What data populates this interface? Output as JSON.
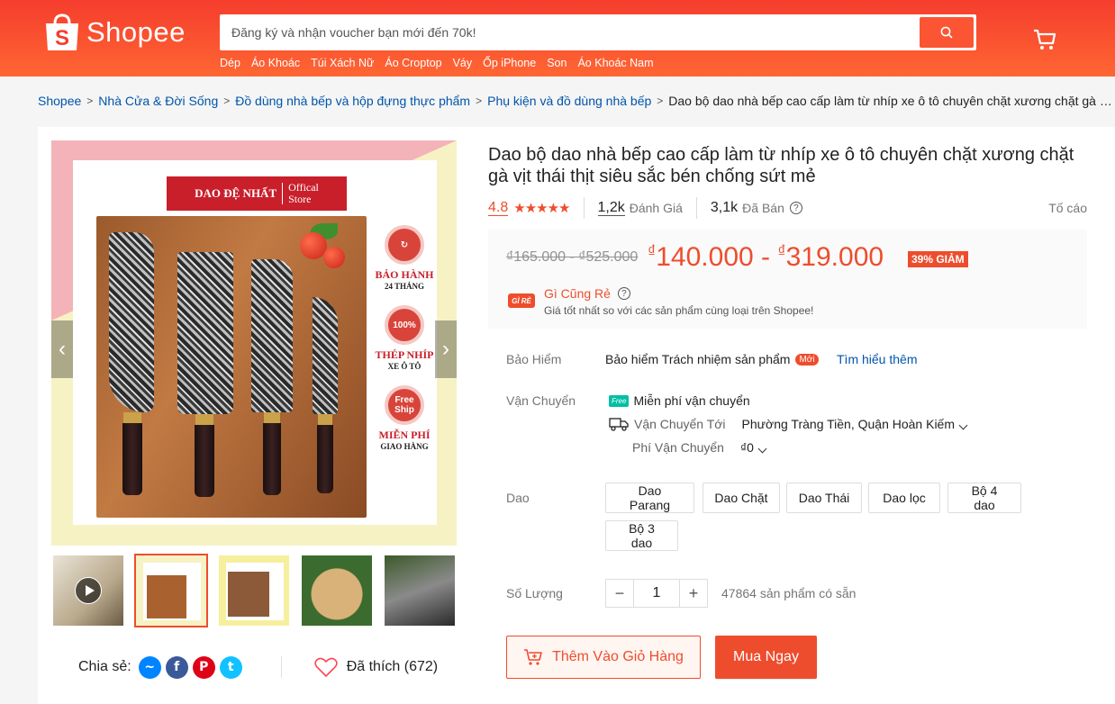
{
  "brand": {
    "name": "Shopee",
    "color": "#ee4d2d"
  },
  "search": {
    "placeholder": "Đăng ký và nhận voucher bạn mới đến 70k!",
    "suggestions": [
      "Dép",
      "Áo Khoác",
      "Túi Xách Nữ",
      "Áo Croptop",
      "Váy",
      "Ốp iPhone",
      "Son",
      "Áo Khoác Nam"
    ]
  },
  "breadcrumb": {
    "items": [
      "Shopee",
      "Nhà Cửa & Đời Sống",
      "Đồ dùng nhà bếp và hộp đựng thực phẩm",
      "Phụ kiện và đồ dùng nhà bếp"
    ],
    "current": "Dao bộ dao nhà bếp cao cấp làm từ nhíp xe ô tô chuyên chặt xương chặt gà vịt thái thịt siêu sắc bén chống sứt mẻ"
  },
  "product": {
    "title": "Dao bộ dao nhà bếp cao cấp làm từ nhíp xe ô tô chuyên chặt xương chặt gà vịt thái thịt siêu sắc bén chống sứt mẻ",
    "rating": "4.8",
    "stars": "★★★★★",
    "reviews_count": "1,2k",
    "reviews_label": "Đánh Giá",
    "sold_count": "3,1k",
    "sold_label": "Đã Bán",
    "report_label": "Tố cáo",
    "old_price": "₫165.000 - ₫525.000",
    "price_currency": "₫",
    "price_low": "140.000",
    "price_sep": " - ",
    "price_high": "319.000",
    "discount": "39% GIẢM",
    "cheap_badge": "GÌ RẺ",
    "cheap_title": "Gì Cũng Rẻ",
    "cheap_desc": "Giá tốt nhất so với các sản phẩm cùng loại trên Shopee!"
  },
  "image": {
    "brand_name": "DAO ĐỆ NHẤT",
    "brand_sub1": "Offical",
    "brand_sub2": "Store",
    "badges": [
      {
        "icon": "↻",
        "t1": "BẢO HÀNH",
        "t2": "24 THÁNG"
      },
      {
        "icon": "100%",
        "t1": "THÉP NHÍP",
        "t2": "XE Ô TÔ"
      },
      {
        "icon": "Free Ship",
        "t1": "MIỄN PHÍ",
        "t2": "GIAO HÀNG"
      }
    ]
  },
  "share": {
    "label": "Chia sẻ:",
    "liked": "Đã thích (672)"
  },
  "insurance": {
    "label": "Bảo Hiểm",
    "text": "Bảo hiểm Trách nhiệm sản phẩm",
    "new_tag": "Mới",
    "learn_more": "Tìm hiểu thêm"
  },
  "shipping": {
    "label": "Vận Chuyển",
    "free_tag": "Free",
    "free_text": "Miễn phí vận chuyển",
    "to_label": "Vận Chuyển Tới",
    "to_value": "Phường Tràng Tiền, Quận Hoàn Kiếm",
    "fee_label": "Phí Vận Chuyển",
    "fee_value": "₫0"
  },
  "variants": {
    "label": "Dao",
    "options": [
      "Dao Parang",
      "Dao Chặt",
      "Dao Thái",
      "Dao lọc",
      "Bộ 4 dao",
      "Bộ 3 dao"
    ]
  },
  "quantity": {
    "label": "Số Lượng",
    "value": "1",
    "minus": "−",
    "plus": "+",
    "stock": "47864 sản phẩm có sẵn"
  },
  "actions": {
    "add_to_cart": "Thêm Vào Giỏ Hàng",
    "buy_now": "Mua Ngay"
  }
}
